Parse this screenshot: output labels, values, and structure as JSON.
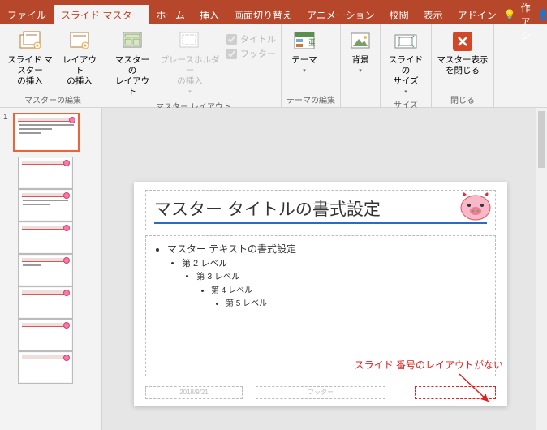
{
  "tabs": {
    "file": "ファイル",
    "slide_master": "スライド マスター",
    "home": "ホーム",
    "insert": "挿入",
    "transitions": "画面切り替え",
    "animations": "アニメーション",
    "review": "校閲",
    "view": "表示",
    "addins": "アドイン",
    "tell_me": "操作アシ",
    "share": "共有"
  },
  "ribbon": {
    "edit_master": {
      "insert_slide_master": "スライド マスター\nの挿入",
      "insert_layout": "レイアウト\nの挿入",
      "group": "マスターの編集"
    },
    "master_layout": {
      "master_layout": "マスターの\nレイアウト",
      "insert_placeholder": "プレースホルダー\nの挿入",
      "title_chk": "タイトル",
      "footer_chk": "フッター",
      "group": "マスター レイアウト"
    },
    "theme_edit": {
      "themes": "テーマ",
      "group": "テーマの編集"
    },
    "background": {
      "background": "背景",
      "group": ""
    },
    "size": {
      "slide_size": "スライドの\nサイズ",
      "group": "サイズ"
    },
    "close": {
      "close_master": "マスター表示\nを閉じる",
      "group": "閉じる"
    }
  },
  "thumbs": {
    "master_num": "1"
  },
  "slide": {
    "title_text": "マスター タイトルの書式設定",
    "bullets": {
      "l1": "マスター テキストの書式設定",
      "l2": "第 2 レベル",
      "l3": "第 3 レベル",
      "l4": "第 4 レベル",
      "l5": "第 5 レベル"
    },
    "footer_date": "2018/9/21",
    "footer_center": "フッター"
  },
  "annotation": "スライド 番号のレイアウトがない"
}
